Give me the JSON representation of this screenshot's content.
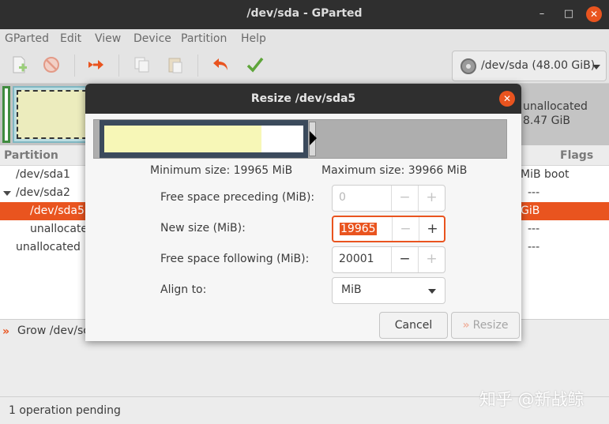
{
  "window": {
    "title": "/dev/sda - GParted",
    "min": "–",
    "max": "□",
    "close": "✕"
  },
  "menu": [
    "GParted",
    "Edit",
    "View",
    "Device",
    "Partition",
    "Help"
  ],
  "toolbar": {
    "device": "/dev/sda (48.00 GiB)"
  },
  "diskmap": {
    "unallocated_label": "unallocated",
    "unallocated_size": "8.47 GiB"
  },
  "partition_list": {
    "headers": {
      "partition": "Partition",
      "flags": "Flags"
    },
    "rows": [
      {
        "name": "/dev/sda1",
        "tail": "MiB",
        "flags": "boot"
      },
      {
        "name": "/dev/sda2",
        "tail": "",
        "flags": "---"
      },
      {
        "name": "/dev/sda5",
        "tail": "GiB",
        "flags": ""
      },
      {
        "name": "unallocate",
        "tail": "",
        "flags": "---"
      },
      {
        "name": "unallocated",
        "tail": "",
        "flags": "---"
      }
    ]
  },
  "operations": {
    "icon": "»",
    "text": "Grow /dev/sc"
  },
  "status": {
    "text": "1 operation pending"
  },
  "watermark": "知乎 @新战鲸",
  "dialog": {
    "title": "Resize /dev/sda5",
    "close": "✕",
    "minimum_size": "Minimum size: 19965 MiB",
    "maximum_size": "Maximum size: 39966 MiB",
    "partition_used_fraction": 0.79,
    "fields": {
      "free_preceding": {
        "label": "Free space preceding (MiB):",
        "value": "0"
      },
      "new_size": {
        "label": "New size (MiB):",
        "value": "19965"
      },
      "free_following": {
        "label": "Free space following (MiB):",
        "value": "20001"
      },
      "align": {
        "label": "Align to:",
        "value": "MiB"
      }
    },
    "spin_minus": "−",
    "spin_plus": "+",
    "cancel": "Cancel",
    "resize": "Resize",
    "resize_icon": "»"
  },
  "colors": {
    "accent": "#e9541f",
    "titlebar": "#2f2f2f",
    "used_space": "#f7f7b7",
    "partition_border": "#3b4a5c"
  }
}
